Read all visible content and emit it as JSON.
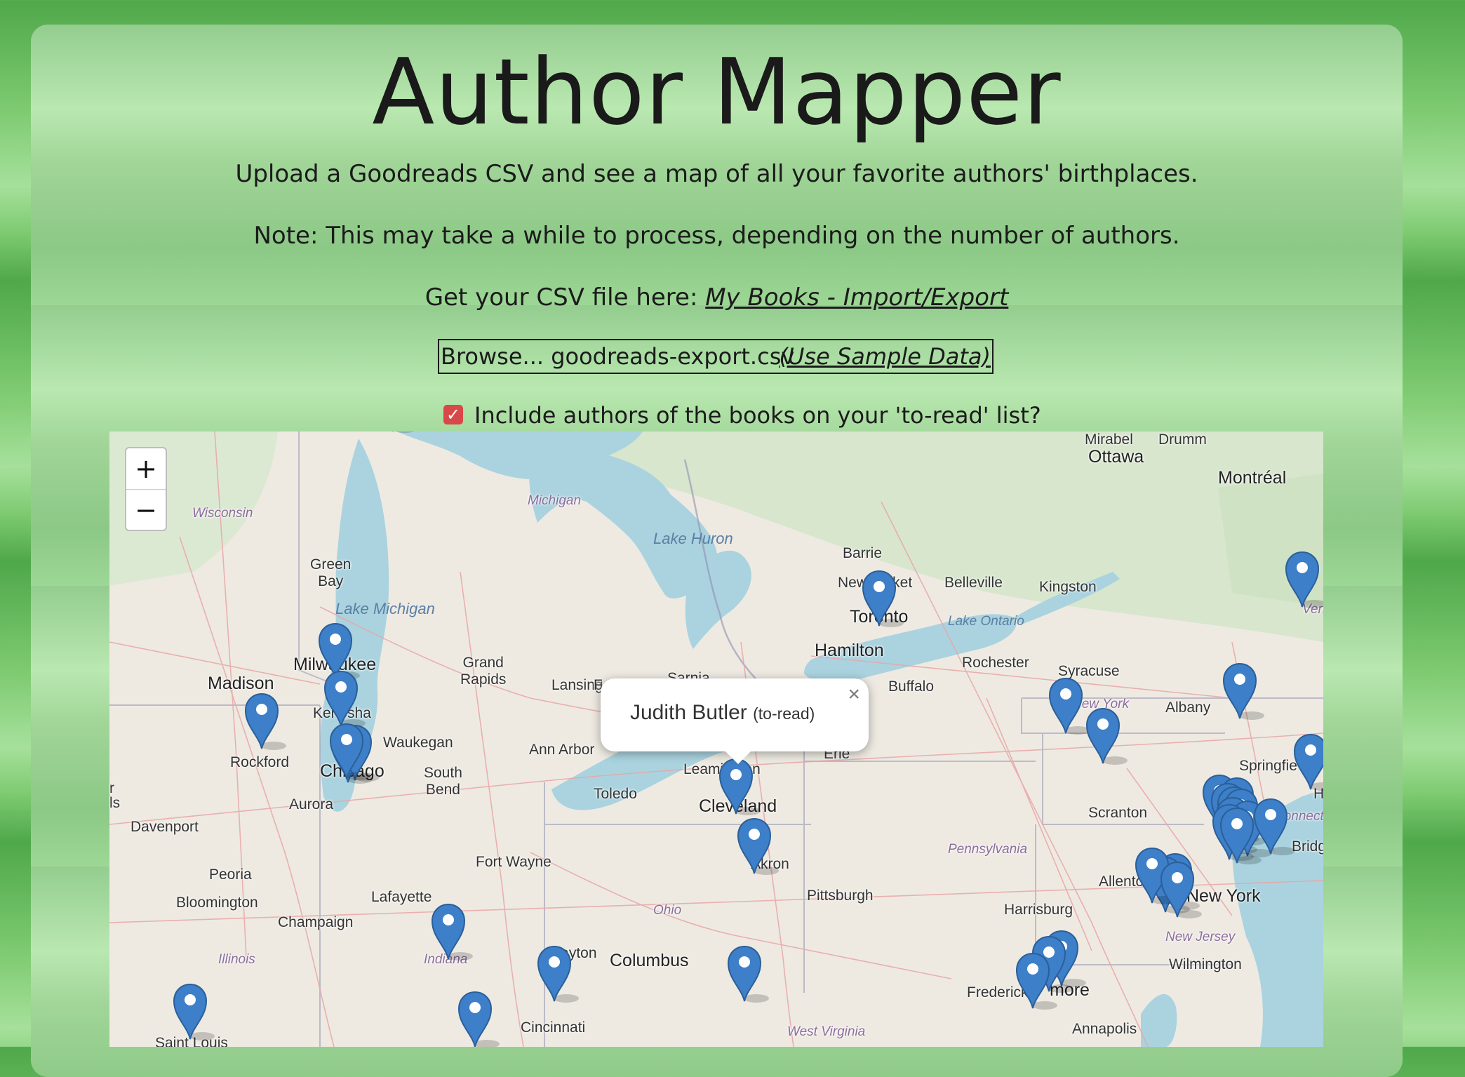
{
  "page": {
    "title": "Author Mapper",
    "intro": "Upload a Goodreads CSV and see a map of all your favorite authors' birthplaces.",
    "note": "Note: This may take a while to process, depending on the number of authors.",
    "csv_prefix": "Get your CSV file here: ",
    "csv_link": "My Books - Import/Export"
  },
  "upload": {
    "browse_label": "Browse...",
    "file_name": "goodreads-export.csv",
    "sample_label": "(Use Sample Data)"
  },
  "toread": {
    "checked": true,
    "check_glyph": "✓",
    "label": "Include authors of the books on your 'to-read' list?"
  },
  "map": {
    "zoom_in": "+",
    "zoom_out": "−",
    "popup": {
      "author": "Judith Butler",
      "tag": "(to-read)",
      "close": "×"
    },
    "labels": {
      "ottawa": "Ottawa",
      "mirabel": "Mirabel",
      "drummondville": "Drumm",
      "montreal": "Montréal",
      "wisconsin": "Wisconsin",
      "michigan": "Michigan",
      "lake_huron": "Lake Huron",
      "green_bay": "Green\nBay",
      "lake_michigan": "Lake Michigan",
      "barrie": "Barrie",
      "newmarket": "Newmarket",
      "belleville": "Belleville",
      "kingston": "Kingston",
      "toronto": "Toronto",
      "lake_ontario": "Lake Ontario",
      "vermont": "Vermo",
      "hamilton": "Hamilton",
      "milwaukee": "Milwaukee",
      "grand_rapids": "Grand\nRapids",
      "madison": "Madison",
      "sarnia": "Sarnia",
      "lansing": "Lansing",
      "flint": "F",
      "buffalo": "Buffalo",
      "rochester": "Rochester",
      "syracuse": "Syracuse",
      "new_york_state": "New York",
      "albany": "Albany",
      "kenosha": "Kenosha",
      "waukegan": "Waukegan",
      "rockford": "Rockford",
      "chicago": "Chicago",
      "ann_arbor": "Ann Arbor",
      "leamington": "Leamington",
      "erie": "Erie",
      "south_bend": "South\nBend",
      "springfield": "Springfie",
      "aurora": "Aurora",
      "toledo": "Toledo",
      "cleveland": "Cleveland",
      "scranton": "Scranton",
      "davenport": "Davenport",
      "connecticut": "Connect",
      "bridgeport": "Bridge",
      "pennsylvania": "Pennsylvania",
      "fort_wayne": "Fort Wayne",
      "akron": "Akron",
      "peoria": "Peoria",
      "allentown": "Allentown",
      "new_york": "New York",
      "bloomington": "Bloomington",
      "lafayette": "Lafayette",
      "pittsburgh": "Pittsburgh",
      "champaign": "Champaign",
      "harrisburg": "Harrisburg",
      "ohio": "Ohio",
      "new_jersey": "New Jersey",
      "illinois": "Illinois",
      "dayton": "Dayton",
      "columbus": "Columbus",
      "wilmington": "Wilmington",
      "indiana": "Indiana",
      "frederick": "Frederick",
      "baltimore": "more",
      "cincinnati": "Cincinnati",
      "annapolis": "Annapolis",
      "west_virginia": "West Virginia",
      "st_louis": "Saint Louis",
      "edge_ls": "ls",
      "edge_r": "r",
      "edge_h": "H"
    },
    "marker_color": "#3d7fc8",
    "marker_count": 42
  }
}
